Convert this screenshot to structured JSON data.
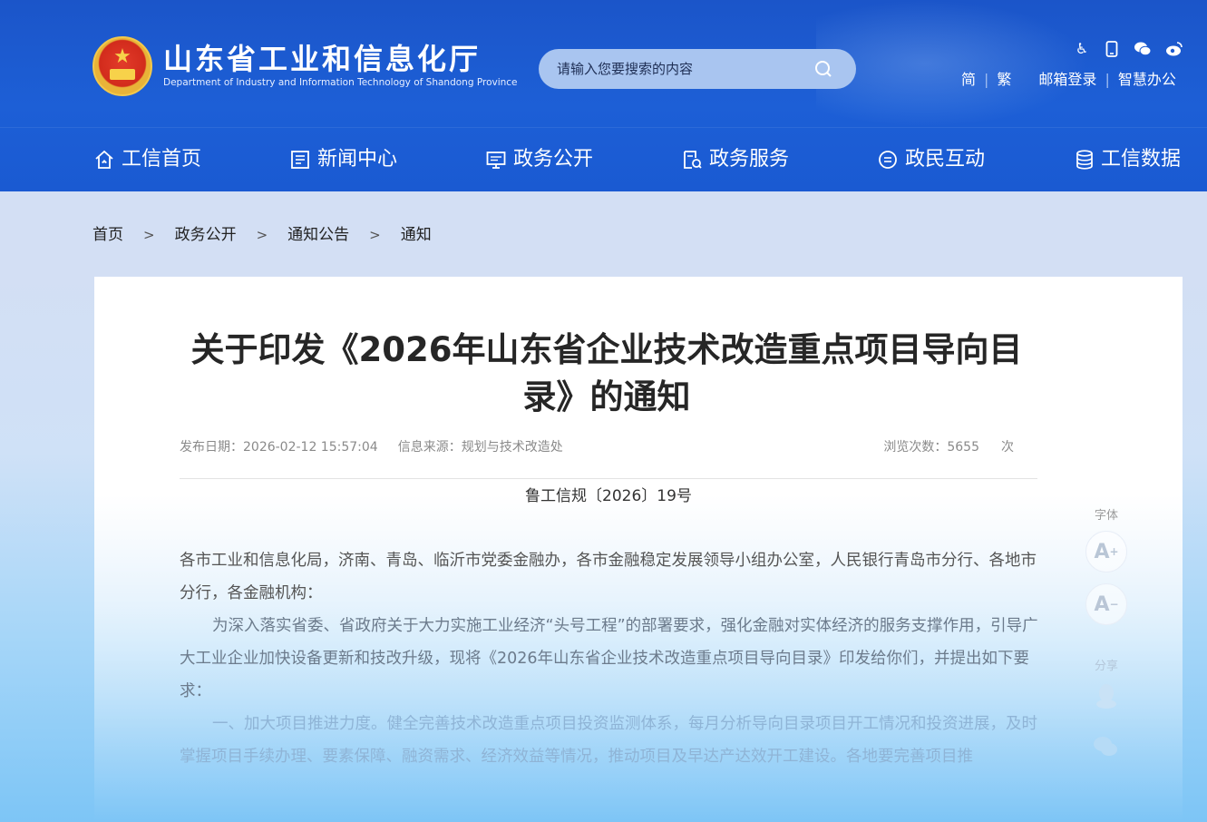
{
  "header": {
    "site_title": "山东省工业和信息化厅",
    "site_subtitle": "Department of Industry and Information Technology of Shandong Province",
    "search_placeholder": "请输入您要搜索的内容",
    "tool_icons": [
      "accessibility-icon",
      "mobile-icon",
      "wechat-icon",
      "weibo-icon"
    ],
    "top_links": {
      "simplified": "简",
      "traditional": "繁",
      "mail_login": "邮箱登录",
      "smart_office": "智慧办公"
    },
    "brand_color": "#1b59d0"
  },
  "nav": [
    {
      "label": "工信首页",
      "icon": "home-icon"
    },
    {
      "label": "新闻中心",
      "icon": "news-icon"
    },
    {
      "label": "政务公开",
      "icon": "monitor-icon"
    },
    {
      "label": "政务服务",
      "icon": "service-icon"
    },
    {
      "label": "政民互动",
      "icon": "chat-icon"
    },
    {
      "label": "工信数据",
      "icon": "database-icon"
    }
  ],
  "breadcrumb": [
    "首页",
    "政务公开",
    "通知公告",
    "通知"
  ],
  "breadcrumb_sep": ">",
  "article": {
    "title": "关于印发《2026年山东省企业技术改造重点项目导向目录》的通知",
    "publish_label": "发布日期：",
    "publish_date": "2026-02-12 15:57:04",
    "source_label": "信息来源：",
    "source": "规划与技术改造处",
    "views_label": "浏览次数：",
    "views": "5655",
    "views_unit": "次",
    "doc_no": "鲁工信规〔2026〕19号",
    "paragraphs": [
      "各市工业和信息化局，济南、青岛、临沂市党委金融办，各市金融稳定发展领导小组办公室，人民银行青岛市分行、各地市分行，各金融机构：",
      "为深入落实省委、省政府关于大力实施工业经济“头号工程”的部署要求，强化金融对实体经济的服务支撑作用，引导广大工业企业加快设备更新和技改升级，现将《2026年山东省企业技术改造重点项目导向目录》印发给你们，并提出如下要求：",
      "一、加大项目推进力度。健全完善技术改造重点项目投资监测体系，每月分析导向目录项目开工情况和投资进展，及时掌握项目手续办理、要素保障、融资需求、经济效益等情况，推动项目及早达产达效开工建设。各地要完善项目推"
    ]
  },
  "side": {
    "font_label": "字体",
    "font_increase": "A",
    "font_increase_sup": "+",
    "font_decrease": "A",
    "font_decrease_sup": "−",
    "share_label": "分享",
    "share_icons": [
      "qq-icon",
      "wechat-share-icon"
    ]
  }
}
